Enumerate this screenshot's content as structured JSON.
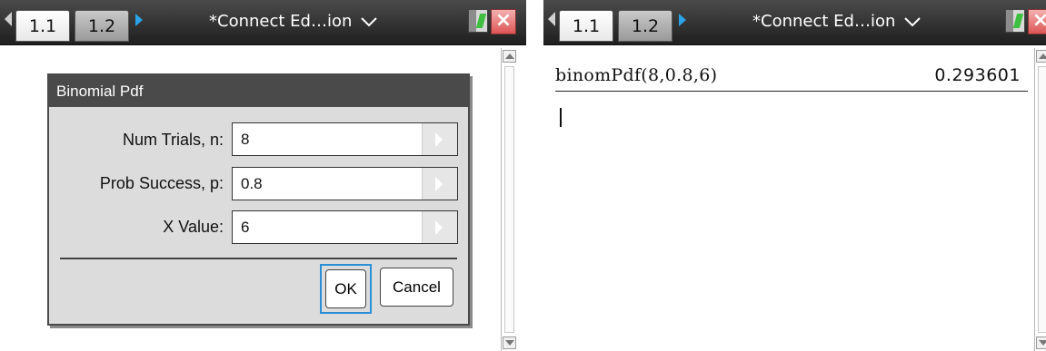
{
  "left_screen": {
    "tabs": [
      {
        "label": "1.1",
        "active": true
      },
      {
        "label": "1.2",
        "active": false
      }
    ],
    "document_title": "*Connect Ed…ion",
    "icons": {
      "prev_page": "triangle-left-icon",
      "next_page": "triangle-right-icon",
      "title_menu": "chevron-down-icon",
      "battery": "battery-icon",
      "close": "close-icon"
    },
    "dialog": {
      "title": "Binomial Pdf",
      "fields": [
        {
          "label": "Num Trials, n:",
          "value": "8"
        },
        {
          "label": "Prob Success, p:",
          "value": "0.8"
        },
        {
          "label": "X Value:",
          "value": "6"
        }
      ],
      "ok_label": "OK",
      "cancel_label": "Cancel"
    }
  },
  "right_screen": {
    "tabs": [
      {
        "label": "1.1",
        "active": true
      },
      {
        "label": "1.2",
        "active": false
      }
    ],
    "document_title": "*Connect Ed…ion",
    "calculator": {
      "expression": "binomPdf(8,0.8,6)",
      "result": "0.293601"
    }
  },
  "colors": {
    "titlebar": "#2b2b2b",
    "dialog_header": "#4a4a4a",
    "focus_border": "#2a8fd6",
    "nav_arrow": "#2aa3e8",
    "close_button": "#dd5555"
  }
}
